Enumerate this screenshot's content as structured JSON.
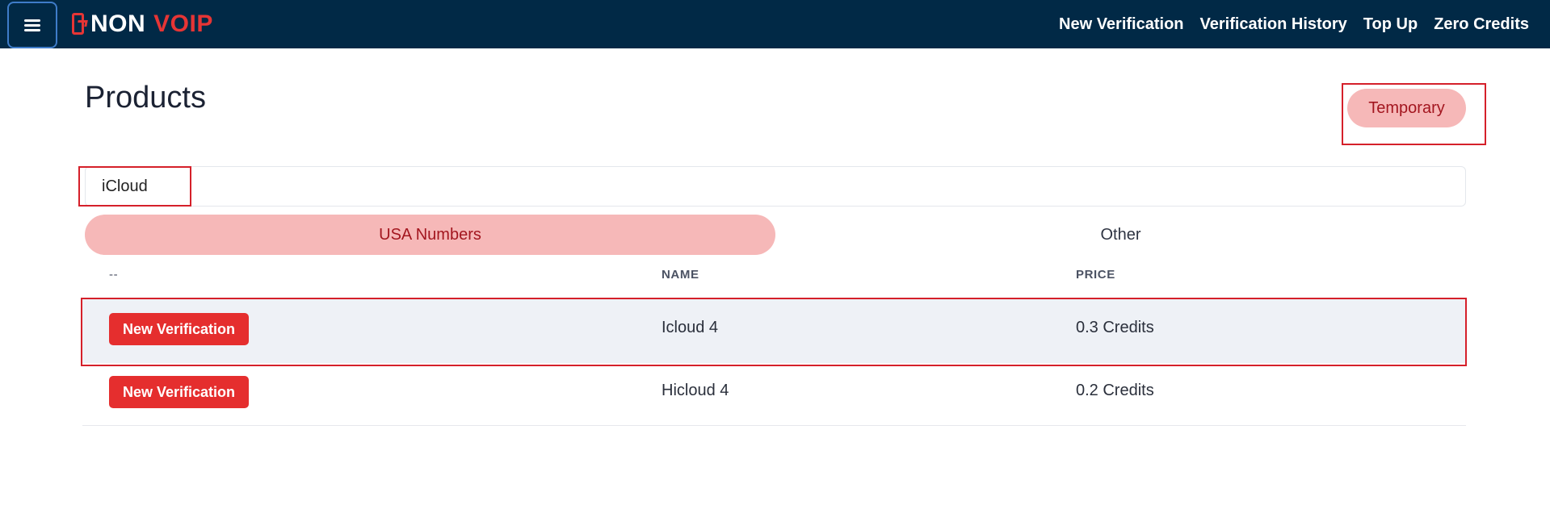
{
  "brand": {
    "part1": "NON",
    "part2": "VOIP"
  },
  "nav": {
    "links": [
      "New Verification",
      "Verification History",
      "Top Up",
      "Zero Credits"
    ]
  },
  "page": {
    "title": "Products"
  },
  "temporary_label": "Temporary",
  "search": {
    "value": "iCloud",
    "placeholder": ""
  },
  "tabs": [
    {
      "label": "USA Numbers",
      "active": true
    },
    {
      "label": "Other",
      "active": false
    }
  ],
  "table": {
    "headers": [
      "--",
      "NAME",
      "PRICE"
    ],
    "rows": [
      {
        "action_label": "New Verification",
        "name": "Icloud 4",
        "price": "0.3 Credits"
      },
      {
        "action_label": "New Verification",
        "name": "Hicloud 4",
        "price": "0.2 Credits"
      }
    ]
  },
  "colors": {
    "navbar": "#012946",
    "accent_red": "#e52e2e",
    "pill_bg": "#f6b8b8",
    "pill_text": "#a3161f",
    "highlight_border": "#d5202a"
  },
  "icons": {
    "menu": "hamburger-icon",
    "logo": "phone-logo-icon"
  }
}
